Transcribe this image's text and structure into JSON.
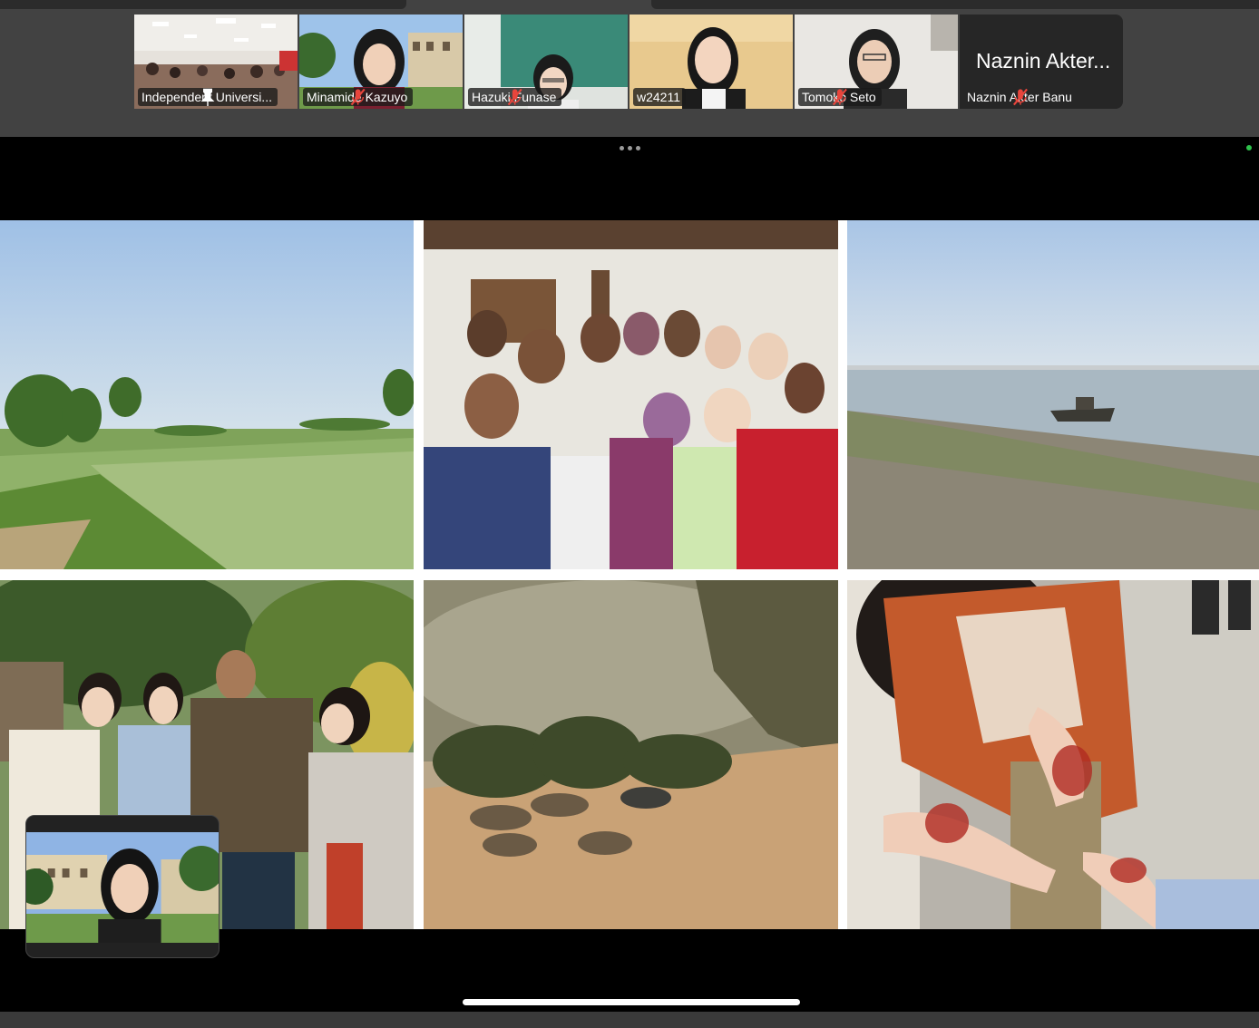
{
  "participants": [
    {
      "name": "Independent Universi...",
      "status_icon": "pin-icon"
    },
    {
      "name": "Minamide Kazuyo",
      "status_icon": "mic-off-icon"
    },
    {
      "name": "Hazuki Funase",
      "status_icon": "mic-off-icon"
    },
    {
      "name": "w24211",
      "status_icon": "",
      "active_speaker": true
    },
    {
      "name": "Tomoko Seto",
      "status_icon": "mic-off-icon"
    },
    {
      "name": "Naznin Akter Banu",
      "display_name_large": "Naznin Akter...",
      "status_icon": "mic-off-icon",
      "video_off": true
    }
  ],
  "colors": {
    "active_speaker_border": "#3ed65b",
    "mic_off_red": "#e8453c",
    "toolbar_bg": "#424242"
  },
  "shared_content": {
    "photos": [
      "rice-field",
      "group-selfie",
      "river-boat",
      "group-photo",
      "ducks-by-pond",
      "henna-hands"
    ]
  }
}
